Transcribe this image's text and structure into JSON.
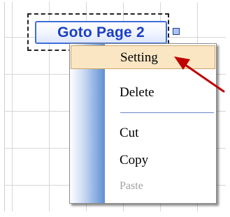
{
  "button": {
    "label": "Goto Page 2"
  },
  "context_menu": {
    "items": [
      {
        "label": "Setting",
        "state": "highlighted"
      },
      {
        "label": "Delete",
        "state": "normal"
      },
      {
        "label": "Cut",
        "state": "normal"
      },
      {
        "label": "Copy",
        "state": "normal"
      },
      {
        "label": "Paste",
        "state": "disabled"
      }
    ]
  },
  "colors": {
    "button_text": "#1a3fc4",
    "button_border": "#3e6fd8",
    "menu_highlight": "#fbe6c4",
    "arrow": "#c00000"
  }
}
